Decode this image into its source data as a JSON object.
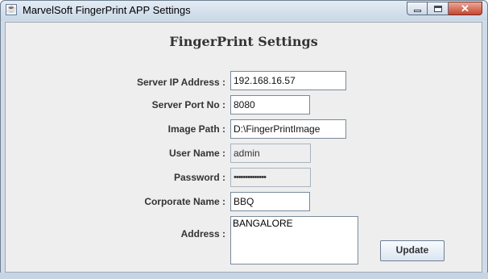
{
  "window": {
    "title": "MarvelSoft FingerPrint APP Settings",
    "icon": "java-icon",
    "close_glyph": "✕"
  },
  "form": {
    "heading": "FingerPrint Settings",
    "fields": [
      {
        "label": "Server IP Address :",
        "value": "192.168.16.57",
        "enabled": true
      },
      {
        "label": "Server Port No :",
        "value": "8080",
        "enabled": true
      },
      {
        "label": "Image Path :",
        "value": "D:\\FingerPrintImage",
        "enabled": true
      },
      {
        "label": "User Name :",
        "value": "admin",
        "enabled": false
      },
      {
        "label": "Password :",
        "value": "••••••••••••••",
        "enabled": false
      },
      {
        "label": "Corporate Name :",
        "value": "BBQ",
        "enabled": true
      },
      {
        "label": "Address :",
        "value": "BANGALORE",
        "enabled": true
      }
    ],
    "update_label": "Update"
  }
}
